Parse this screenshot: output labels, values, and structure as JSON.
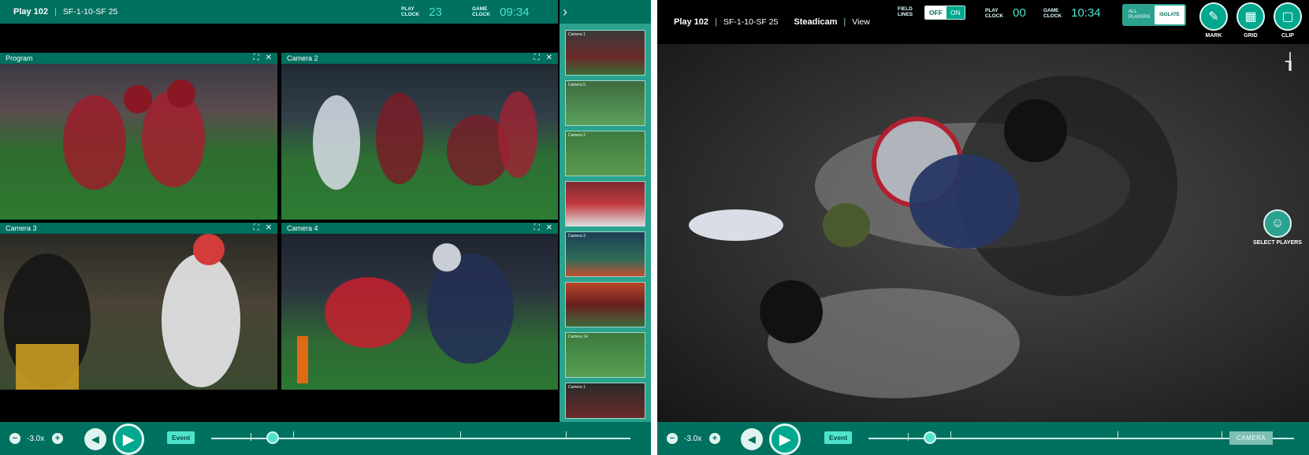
{
  "left": {
    "title": "Play 102",
    "code": "SF-1-10-SF 25",
    "play_clock_label": [
      "PLAY",
      "CLOCK"
    ],
    "play_clock": "23",
    "game_clock_label": [
      "GAME",
      "CLOCK"
    ],
    "game_clock": "09:34",
    "tiles": [
      {
        "name": "Program"
      },
      {
        "name": "Camera 2"
      },
      {
        "name": "Camera 3"
      },
      {
        "name": "Camera 4"
      }
    ],
    "thumbnails": [
      "Camera 1",
      "Camera 5",
      "Camera 2",
      "",
      "Camera 3",
      "",
      "Camera 14",
      "Camera 1"
    ],
    "zoom": "-3.0x",
    "event_label": "Event"
  },
  "right": {
    "title": "Play 102",
    "code": "SF-1-10-SF 25",
    "camera_name": "Steadicam",
    "view_label": "View",
    "field_lines_label": [
      "FIELD",
      "LINES"
    ],
    "field_off": "OFF",
    "field_on": "ON",
    "play_clock_label": [
      "PLAY",
      "CLOCK"
    ],
    "play_clock": "00",
    "game_clock_label": [
      "GAME",
      "CLOCK"
    ],
    "game_clock": "10:34",
    "all_players": [
      "ALL",
      "PLAYERS"
    ],
    "isolate": "ISOLATE",
    "tools": [
      "MARK",
      "GRID",
      "CLIP"
    ],
    "select_players": "SELECT PLAYERS",
    "zoom": "-3.0x",
    "event_label": "Event",
    "camera_button": "CAMERA"
  },
  "colors": {
    "accent": "#00705f",
    "highlight": "#4fe3cc",
    "panel_teal": "#2aa28e"
  },
  "icons": [
    "expand-icon",
    "close-icon",
    "chevron-right-icon",
    "minus-icon",
    "plus-icon",
    "step-back-icon",
    "play-icon",
    "pencil-icon",
    "grid-icon",
    "clip-icon",
    "collapse-icon",
    "select-players-icon"
  ]
}
